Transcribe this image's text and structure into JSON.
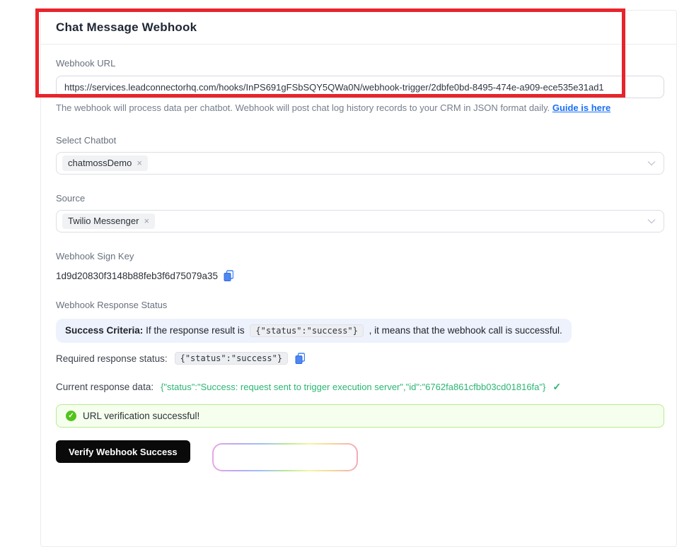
{
  "icons": {
    "close": "×",
    "check": "✓"
  },
  "annotation": {
    "color": "#e8242b"
  },
  "card": {
    "title": "Chat Message Webhook",
    "webhook_url": {
      "label": "Webhook URL",
      "value": "https://services.leadconnectorhq.com/hooks/InPS691gFSbSQY5QWa0N/webhook-trigger/2dbfe0bd-8495-474e-a909-ece535e31ad1",
      "help_text": "The webhook will process data per chatbot. Webhook will post chat log history records to your CRM in JSON format daily. ",
      "help_link": "Guide is here"
    },
    "select_chatbot": {
      "label": "Select Chatbot",
      "selected": [
        {
          "label": "chatmossDemo"
        }
      ]
    },
    "source": {
      "label": "Source",
      "selected": [
        {
          "label": "Twilio Messenger"
        }
      ]
    },
    "sign_key": {
      "label": "Webhook Sign Key",
      "value": "1d9d20830f3148b88feb3f6d75079a35"
    },
    "response_status": {
      "label": "Webhook Response Status",
      "criteria_bold": "Success Criteria:",
      "criteria_pre": " If the response result is ",
      "criteria_code": "{\"status\":\"success\"}",
      "criteria_post": " , it means that the webhook call is successful.",
      "required_label": "Required response status:",
      "required_code": "{\"status\":\"success\"}",
      "current_label": "Current response data:",
      "current_value": "{\"status\":\"Success: request sent to trigger execution server\",\"id\":\"6762fa861cfbb03cd01816fa\"}"
    },
    "alert": {
      "message": "URL verification successful!"
    },
    "verify_button_label": "Verify Webhook Success"
  },
  "colors": {
    "success_green": "#2bb673",
    "alert_bg": "#f6ffed",
    "alert_border": "#b7eb8f",
    "link_blue": "#1a6ff5",
    "annotation_red": "#e8242b"
  }
}
